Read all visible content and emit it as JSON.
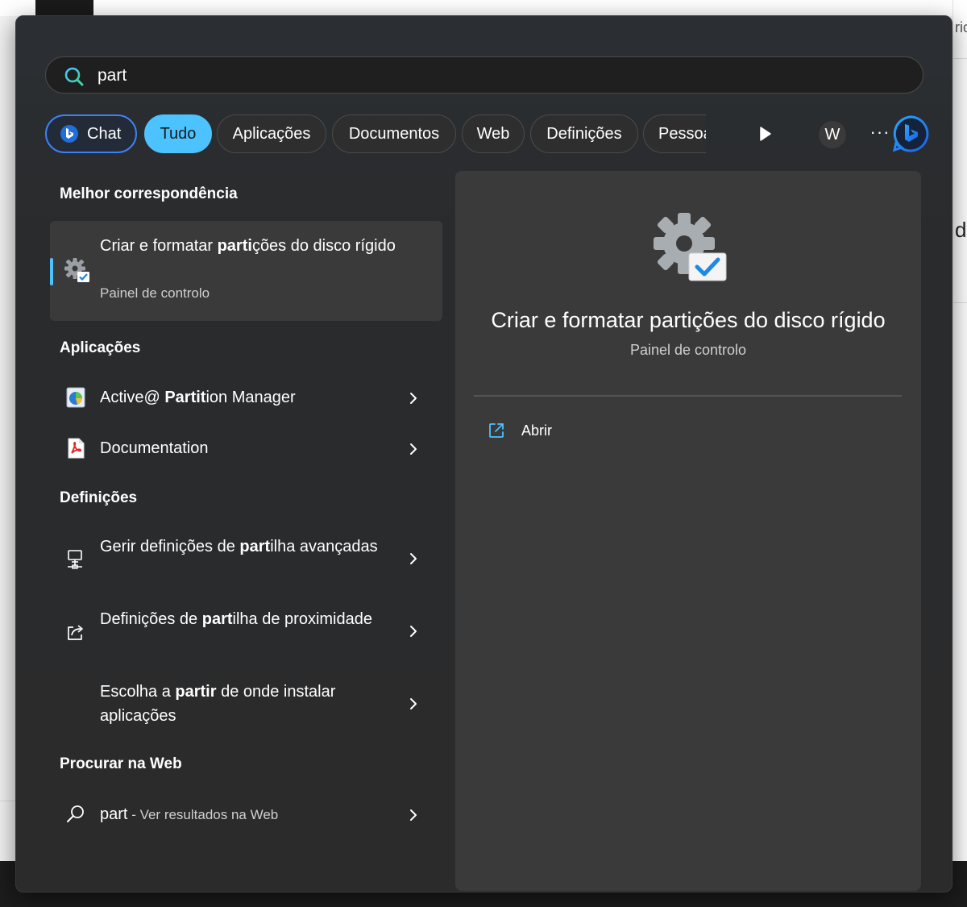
{
  "background": {
    "right_text_1": "rio",
    "right_text_2": "dc"
  },
  "search": {
    "value": "part",
    "icon": "search-icon"
  },
  "tabs": [
    {
      "label": "Chat"
    },
    {
      "label": "Tudo"
    },
    {
      "label": "Aplicações"
    },
    {
      "label": "Documentos"
    },
    {
      "label": "Web"
    },
    {
      "label": "Definições"
    },
    {
      "label": "Pessoas"
    }
  ],
  "toolbar": {
    "avatar_letter": "W",
    "more_label": "···"
  },
  "best_match": {
    "section_title": "Melhor correspondência",
    "title_pre": "Criar e formatar ",
    "title_bold": "parti",
    "title_post": "ções do disco rígido",
    "subtitle": "Painel de controlo"
  },
  "apps": {
    "section_title": "Aplicações",
    "items": [
      {
        "pre": "Active@ ",
        "bold": "Partit",
        "post": "ion Manager"
      },
      {
        "pre": "Documentation",
        "bold": "",
        "post": ""
      }
    ]
  },
  "settings": {
    "section_title": "Definições",
    "items": [
      {
        "pre": "Gerir definições de ",
        "bold": "part",
        "post": "ilha avançadas"
      },
      {
        "pre": "Definições de ",
        "bold": "part",
        "post": "ilha de proximidade"
      },
      {
        "pre": "Escolha a ",
        "bold": "partir",
        "post": " de onde instalar aplicações"
      }
    ]
  },
  "web": {
    "section_title": "Procurar na Web",
    "query": "part",
    "suffix": " - Ver resultados na Web"
  },
  "detail": {
    "title": "Criar e formatar partições do disco rígido",
    "subtitle": "Painel de controlo",
    "open_label": "Abrir"
  },
  "colors": {
    "accent": "#4cc2ff",
    "chat_border": "#3b82f6",
    "panel": "#2b2b2b",
    "card": "#3a3a3a"
  }
}
